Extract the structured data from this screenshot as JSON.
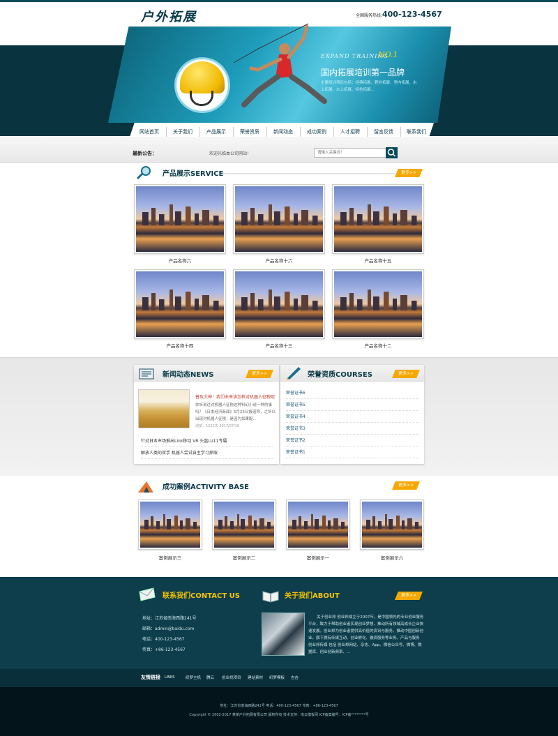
{
  "header": {
    "logo": "户外拓展",
    "hotline_label": "全国服务热线：",
    "hotline": "400-123-4567"
  },
  "banner": {
    "expand_en": "EXPAND TRAINING",
    "expand_no": "NO.1",
    "slogan": "国内拓展培训第一品牌",
    "slogan_sub": "主要培训项目包括：经典拓展、野外拓展、室内拓展、水上拓展、水上拓展、特色拓展..."
  },
  "nav": {
    "items": [
      "网站首页",
      "关于我们",
      "产品展示",
      "荣誉资质",
      "新闻动态",
      "成功案例",
      "人才招聘",
      "留言反馈",
      "联系我们"
    ]
  },
  "notice": {
    "label": "最新公告：",
    "text": "欢迎光临本公司网站！",
    "search_placeholder": "请输入关键词！"
  },
  "products": {
    "title": "产品展示SERVICE",
    "more": "更多>>",
    "items": [
      "产品名称六",
      "产品名称十六",
      "产品名称十五",
      "产品名称十四",
      "产品名称十三",
      "产品名称十二"
    ]
  },
  "news": {
    "title": "新闻动态NEWS",
    "more": "更多>>",
    "featured_title": "普及大神！我们未来该怎样对机器人征税呢",
    "featured_desc": "你听说过对机器人征税这种科幻小说一样的事吗？《日本经济新闻》5月25日报道称，之所以出现对机器人征税，是因为如果配...",
    "featured_date": "浏览：1222次 2017/07/10",
    "items": [
      "针对日本市场推出Link移动 VR 头盔LU11专属",
      "解放人类的双手 机器人尝试自主学习抓取"
    ]
  },
  "honors": {
    "title": "荣誉资质COURSES",
    "more": "更多>>",
    "items": [
      "荣誉证书6",
      "荣誉证书5",
      "荣誉证书4",
      "荣誉证书3",
      "荣誉证书2",
      "荣誉证书1"
    ]
  },
  "cases": {
    "title": "成功案例ACTIVITY BASE",
    "more": "更多>>",
    "items": [
      "案例展示三",
      "案例展示二",
      "案例展示一",
      "案例展示六"
    ]
  },
  "contact": {
    "title": "联系我们CONTACT US",
    "lines": [
      "地址：江苏省南海西路241号",
      "邮箱：admin@baidu.com",
      "电话：400-123-4567",
      "传真：+86-123-4567"
    ]
  },
  "about": {
    "title": "关于我们ABOUT",
    "more": "更多>>",
    "text": "关于创业邦 创业邦成立于2007年，是中国领先的专业创业服务平台，致力于帮助创业者实现创业梦想，推动所有领域高成长企业快速发展。创业邦为创业者提供高价值的资讯与服务，推动中国创新创业。旗下拥有传媒互动、创业孵化、融资服务等业务。产品与服务 创业邦传媒 包括 创业邦网站、杂志、App、微信公众号、微博、数据库、创业创新频率、..."
  },
  "links": {
    "label": "友情链接",
    "sub": "LINKS",
    "items": [
      "织梦主机",
      "腾云",
      "创业找项目",
      "建站素材",
      "织梦模板",
      "吉吉"
    ]
  },
  "footer": {
    "address_line": "地址：江苏省南海西路241号 电话：400-123-4567 传真：+86-123-4567",
    "copyright": "Copyright © 2002-2017 某某户外拓展有限公司 版权所有 技术支持：南云模板网 ICP备案编号：ICP备********号"
  },
  "colors": {
    "primary": "#0b3a48",
    "accent": "#f5a800",
    "footer": "#0e3e4c"
  }
}
